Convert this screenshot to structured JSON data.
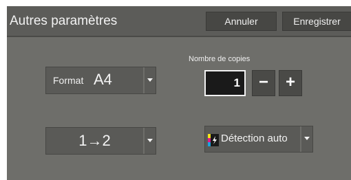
{
  "header": {
    "title": "Autres paramètres",
    "cancel_label": "Annuler",
    "save_label": "Enregistrer"
  },
  "format": {
    "label": "Format",
    "value": "A4"
  },
  "copies": {
    "label": "Nombre de copies",
    "value": "1",
    "minus": "−",
    "plus": "+"
  },
  "duplex": {
    "value": "1→2"
  },
  "color_mode": {
    "value": "Détection auto",
    "icon": "color-auto-detect-icon"
  },
  "colors": {
    "panel_bg": "#6e6e6a",
    "titlebar_bg": "#5c5c59",
    "button_bg": "#474744",
    "input_bg": "#1a1a1a",
    "text": "#f2f2f2"
  }
}
